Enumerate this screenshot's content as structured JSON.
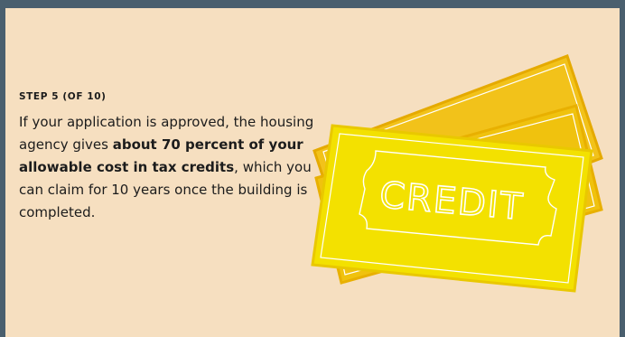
{
  "slide": {
    "step_label": "STEP 5 (OF 10)",
    "text_1": "If your application is approved, the housing agency gives ",
    "text_bold": "about 70 percent of your allowable cost in tax credits",
    "text_2": ", which you can claim for 10 years once the building is completed."
  },
  "illustration": {
    "ticket_text": "CREDIT",
    "colors": {
      "ticket_main": "#f3e100",
      "ticket_back": "#f2c21a",
      "ticket_edge": "#e8b400",
      "outline": "#ffffff",
      "background": "#f6dfc0",
      "frame": "#4a5f6e"
    }
  }
}
